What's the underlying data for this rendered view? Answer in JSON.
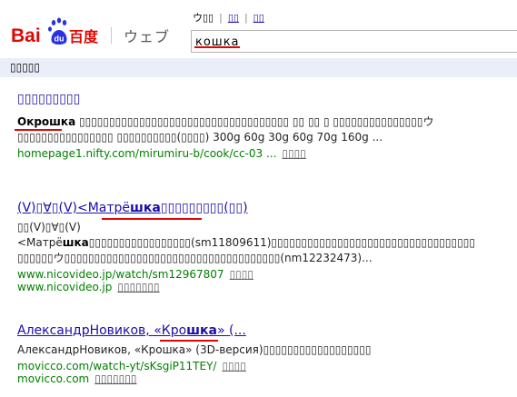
{
  "brand": {
    "name": "Baidu",
    "subtitle": "ウェブ",
    "colors": {
      "red": "#e10601",
      "blue": "#2932e1",
      "link": "#1a0dab",
      "url_green": "#008000"
    }
  },
  "topnav": {
    "items": [
      "ウ▯▯",
      "▯▯",
      "▯▯"
    ]
  },
  "search": {
    "value": "кошка"
  },
  "bar": {
    "label": "▯▯▯▯▯"
  },
  "results": [
    {
      "title": "▯▯▯▯▯▯▯▯▯",
      "snippet_bold": "Окрошка",
      "snippet": " ▯▯▯▯▯▯▯▯▯▯▯▯▯▯▯▯▯▯▯▯▯▯▯▯▯▯▯▯▯▯▯▯▯▯▯ ▯▯ ▯▯ ▯ ▯▯▯▯▯▯▯▯▯▯▯▯▯▯▯ウ▯▯▯▯▯▯▯▯▯▯▯▯▯▯▯▯ ▯▯▯▯▯▯▯▯▯▯(▯▯▯▯) 300g 60g 30g 60g 70g 160g ...",
      "url": "homepage1.nifty.com/mirumiru-b/cook/cc-03 ...",
      "cache": "▯▯▯▯"
    },
    {
      "title_pre": "(V)▯∀▯(V)<Матрё",
      "title_bold": "шка",
      "title_post": "▯▯▯▯▯▯▯▯▯(▯▯)",
      "snippet_pre": "▯▯(V)▯∀▯(V)<Матрё",
      "snippet_bold": "шка",
      "snippet_post": "▯▯▯▯▯▯▯▯▯▯▯▯▯▯▯▯▯(sm11809611)▯▯▯▯▯▯▯▯▯▯▯▯▯▯▯▯▯▯▯▯▯▯▯▯▯▯▯▯▯▯▯▯▯▯ ▯▯▯▯▯▯ウ▯▯▯▯▯▯▯▯▯▯▯▯▯▯▯▯▯▯▯▯▯▯▯▯▯▯▯▯▯▯▯▯▯▯▯▯(nm12232473)...",
      "url": "www.nicovideo.jp/watch/sm12967807",
      "cache": "▯▯▯▯",
      "site": "www.nicovideo.jp",
      "more": "▯▯▯▯▯▯▯"
    },
    {
      "title_pre": "АлександрНовиков, «Кро",
      "title_bold": "шка",
      "title_post": "» (...",
      "snippet": "АлександрНовиков, «Крошка» (3D-версия)▯▯▯▯▯▯▯▯▯▯▯▯▯▯▯▯▯▯",
      "url": "movicco.com/watch-yt/sKsgiP11TEY/",
      "cache": "▯▯▯▯",
      "site": "movicco.com",
      "more": "▯▯▯▯▯▯▯"
    }
  ]
}
